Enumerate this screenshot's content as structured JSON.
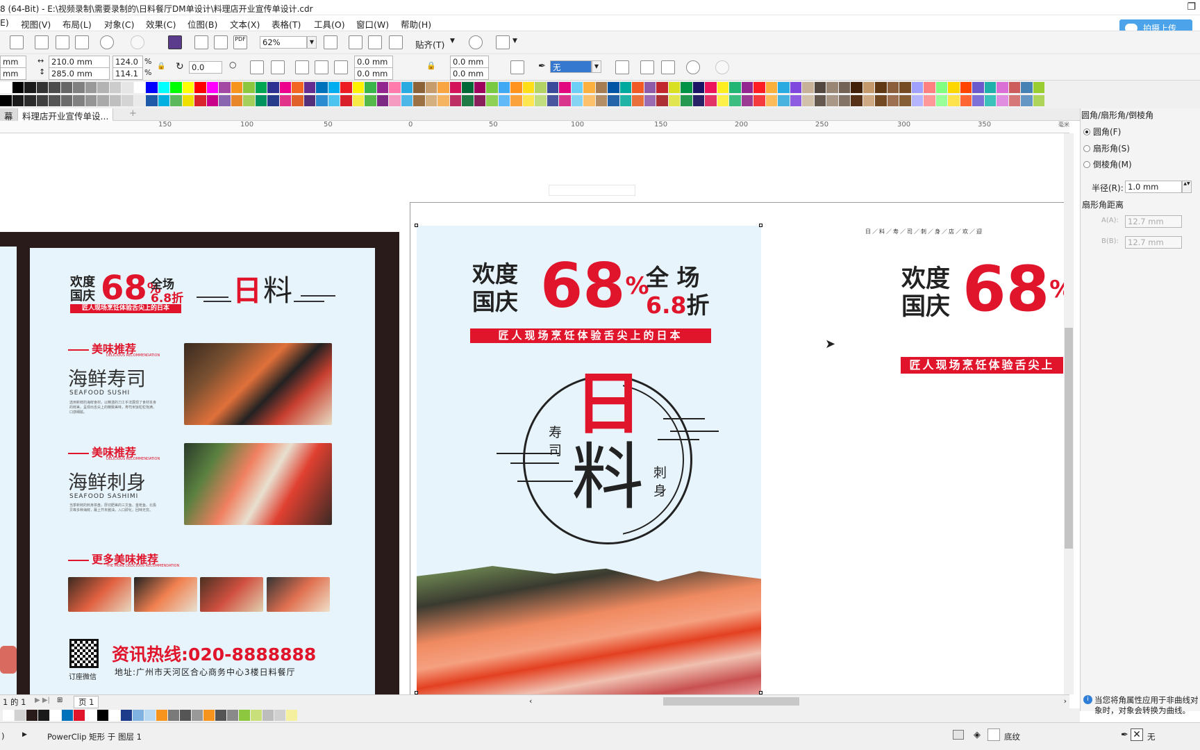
{
  "window": {
    "title": "8 (64-Bit) - E:\\视频录制\\需要录制的\\日料餐厅DM单设计\\料理店开业宣传单设计.cdr"
  },
  "menu": [
    "E)",
    "视图(V)",
    "布局(L)",
    "对象(C)",
    "效果(C)",
    "位图(B)",
    "文本(X)",
    "表格(T)",
    "工具(O)",
    "窗口(W)",
    "帮助(H)"
  ],
  "cloud_button": "拍摄上传",
  "toolbar": {
    "zoom": "62%",
    "snap": "贴齐(T)"
  },
  "propbar": {
    "unit_top": "mm",
    "unit_bottom": "mm",
    "width": "210.0 mm",
    "height": "285.0 mm",
    "scale_x": "124.0",
    "scale_y": "114.1",
    "percent": "%",
    "rotation": "0.0",
    "corner_1": "0.0 mm",
    "corner_2": "0.0 mm",
    "corner_3": "0.0 mm",
    "corner_4": "0.0 mm",
    "outline": "无"
  },
  "colors": {
    "accent": "#e0142b",
    "flyer_bg": "#e7f4fb",
    "dark_bg": "#2a1b1b",
    "brand_blue": "#4ca3ea"
  },
  "palette_row1": [
    "#ffffff",
    "#000000",
    "#1a1a1a",
    "#333333",
    "#4d4d4d",
    "#666666",
    "#808080",
    "#999999",
    "#b3b3b3",
    "#cccccc",
    "#e6e6e6",
    "#ffffff",
    "#0000ff",
    "#00ffff",
    "#00ff00",
    "#ffff00",
    "#ff0000",
    "#ff00ff",
    "#a349a4",
    "#f7941d",
    "#8dc63f",
    "#00a651",
    "#2e3192",
    "#ec008c",
    "#f26522",
    "#662d91",
    "#0072bc",
    "#00aeef",
    "#ed1c24",
    "#fff200",
    "#39b54a",
    "#92278f",
    "#ff7bac",
    "#29abe2",
    "#8c6239",
    "#c69c6d",
    "#f9a541",
    "#d4145a",
    "#006837",
    "#9e005d",
    "#7ac943",
    "#3fa9f5",
    "#ff931e",
    "#ffde17",
    "#b3d465",
    "#3c4a9c",
    "#e2077e",
    "#6ecff6",
    "#fbb040",
    "#a67c52",
    "#0054a6",
    "#00a99d",
    "#f15a24",
    "#8e5ba8",
    "#c1272d",
    "#d9e021",
    "#009245",
    "#1b1464",
    "#ed145b",
    "#fcee21",
    "#22b573",
    "#93278f",
    "#ff1d25",
    "#fbb03b",
    "#29abe2",
    "#7f47dd",
    "#c7b299",
    "#534741",
    "#998675",
    "#736357",
    "#42210b",
    "#c49a6c",
    "#603813",
    "#8b5e3c",
    "#754c24",
    "#a0a0ff",
    "#ff8080",
    "#80ff80",
    "#ffd700",
    "#ff4500",
    "#6a5acd",
    "#20b2aa",
    "#da70d6",
    "#cd5c5c",
    "#4682b4",
    "#9acd32"
  ],
  "palette_row2": [
    "#000000",
    "#1a1a1a",
    "#2b2b2b",
    "#404040",
    "#555555",
    "#6b6b6b",
    "#808080",
    "#959595",
    "#aaaaaa",
    "#bfbfbf",
    "#d4d4d4",
    "#eaeaea",
    "#1e5aa8",
    "#00b0e0",
    "#5cb85c",
    "#f0e000",
    "#d9232d",
    "#c8008a",
    "#8b66b0",
    "#e8872a",
    "#a4cf5a",
    "#00935f",
    "#283c8c",
    "#e1338a",
    "#e0622a",
    "#55307a",
    "#2b8ccf",
    "#4dc4f0",
    "#d8202a",
    "#f7eb48",
    "#57b84a",
    "#7d2a85",
    "#f59ac0",
    "#4db8e8",
    "#9c7245",
    "#d4b080",
    "#f4b462",
    "#be2f63",
    "#1f7a46",
    "#89205b",
    "#8fd057",
    "#62b9f7",
    "#fba23c",
    "#fde64f",
    "#c2dc80",
    "#4a579e",
    "#d9358c",
    "#86d4f3",
    "#fcc16a",
    "#b48e66",
    "#2564a8",
    "#21b3a6",
    "#e9703b",
    "#9b6cb1",
    "#ad3035",
    "#e1e650",
    "#269950",
    "#2a2266",
    "#e23467",
    "#fdf04b",
    "#3dbd80",
    "#9c3b94",
    "#f53b3e",
    "#fcbc5a",
    "#49b3e0",
    "#8e5ce0",
    "#d1c1ab",
    "#66594f",
    "#a99788",
    "#837366",
    "#573218",
    "#cfa983",
    "#744a24",
    "#9c7050",
    "#875f37",
    "#b5b5ff",
    "#ff9999",
    "#99ff99",
    "#ffe34d",
    "#ff6633",
    "#7d70d6",
    "#3cc2bb",
    "#e08ee0",
    "#d67878",
    "#6597c4",
    "#aed55a"
  ],
  "tabs": [
    "幕",
    "料理店开业宣传单设..."
  ],
  "ruler": [
    "150",
    "100",
    "50",
    "0",
    "50",
    "100",
    "150",
    "200",
    "250",
    "300",
    "350",
    "毫米"
  ],
  "left_flyer": {
    "headline_a": "欢度",
    "headline_b": "国庆",
    "pct": "68",
    "pct_sign": "%",
    "all": "全场",
    "discount": "6.8折",
    "banner": "匠人现场烹饪体验舌尖上的日本",
    "logo_a": "日",
    "logo_b": "料",
    "section1_tag": "美味推荐",
    "section1_sub": "DELICIOUS RECOMMENDATION",
    "item1_title": "海鲜寿司",
    "item1_en": "SEAFOOD SUSHI",
    "item1_desc": "选用新鲜的海鲜食材，以精湛的刀工手法展现了食材本身的鲜美，呈现出舌尖上的精致美味，寿司米饭粒粒饱满，口感细腻。",
    "section2_tag": "美味推荐",
    "section2_sub": "DELICIOUS RECOMMENDATION",
    "item2_title": "海鲜刺身",
    "item2_en": "SEAFOOD SASHIMI",
    "item2_desc": "当季新鲜的刺身拼盘，厚切肥美的三文鱼、金枪鱼、北极贝等多种海鲜，蘸上芥末酱油，入口即化，回味无穷。",
    "section3_tag": "更多美味推荐",
    "section3_sub": "THE MORE DELICIOUS RECOMMENDATION",
    "hotline": "资讯热线:020-8888888",
    "qr_label": "订座微信",
    "address": "地址:广州市天河区合心商务中心3楼日料餐厅"
  },
  "main_flyer": {
    "headline_a": "欢度",
    "headline_b": "国庆",
    "pct": "68",
    "pct_sign": "%",
    "all": "全 场",
    "discount_num": "6.8",
    "discount_unit": "折",
    "banner": "匠人现场烹饪体验舌尖上的日本",
    "logo_a": "日",
    "logo_b": "料",
    "side_left_a": "寿",
    "side_left_b": "司",
    "side_right_a": "刺",
    "side_right_b": "身"
  },
  "right_preview": {
    "headline_a": "欢度",
    "headline_b": "国庆",
    "pct": "68",
    "pct_sign": "%",
    "banner": "匠人现场烹饪体验舌尖上",
    "small_row": "日／料／寿／司／刺／身／店／欢／迎"
  },
  "docker": {
    "title": "圆角/扇形角/倒棱角",
    "opt_round": "圆角(F)",
    "opt_scallop": "扇形角(S)",
    "opt_chamfer": "倒棱角(M)",
    "radius_label": "半径(R):",
    "radius_value": "1.0 mm",
    "distance_label": "扇形角距离",
    "a_label": "A(A):",
    "a_value": "12.7 mm",
    "b_label": "B(B):",
    "b_value": "12.7 mm",
    "info": "当您将角属性应用于非曲线对象时，对象会转换为曲线。"
  },
  "pagebar": {
    "nav": "1 的 1",
    "page": "页 1"
  },
  "doc_palette": [
    "#ffffff",
    "#d2d2d2",
    "#2a1b1b",
    "#1a1a1a",
    "#ffffff",
    "#0072bc",
    "#e0142b",
    "#ffffff",
    "#000000",
    "#ffffff",
    "#1e3a8a",
    "#7fb2e0",
    "#b9d9f3",
    "#f7941d",
    "#7a7a7a",
    "#555555",
    "#999999",
    "#f7941d",
    "#555555",
    "#8a8a8a",
    "#8dc63f",
    "#c9e07a",
    "#bdbdbd",
    "#d0d0d0",
    "#f5f0a0"
  ],
  "status": {
    "left": ")",
    "object": "PowerClip 矩形 于 图层 1",
    "fill": "底纹",
    "outline": "无"
  }
}
